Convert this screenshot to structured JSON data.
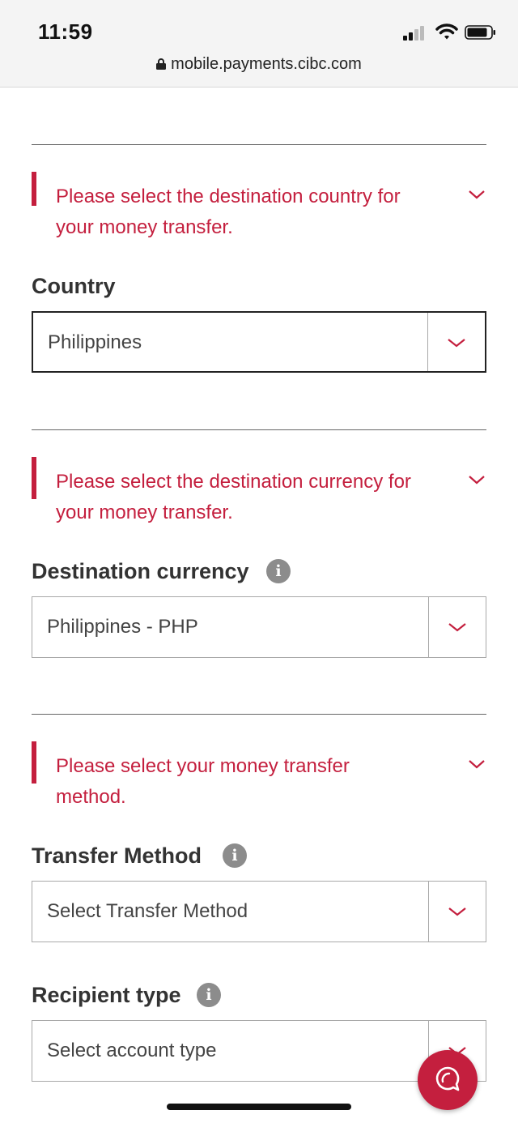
{
  "status_bar": {
    "time": "11:59"
  },
  "browser": {
    "url": "mobile.payments.cibc.com"
  },
  "sections": {
    "country": {
      "alert": "Please select the destination country for your money transfer.",
      "label": "Country",
      "value": "Philippines"
    },
    "currency": {
      "alert": "Please select the destination currency for your money transfer.",
      "label": "Destination currency",
      "value": "Philippines - PHP"
    },
    "method": {
      "alert": "Please select your money transfer method.",
      "label": "Transfer Method",
      "placeholder": "Select Transfer Method"
    },
    "recipient": {
      "label": "Recipient type",
      "placeholder": "Select account type"
    }
  },
  "colors": {
    "accent": "#c41f3e",
    "text": "#333333",
    "info_icon": "#8c8c8c"
  },
  "icons": {
    "info": "i",
    "chevron": "chevron-down-icon",
    "chat": "chat-icon",
    "lock": "lock-icon"
  }
}
